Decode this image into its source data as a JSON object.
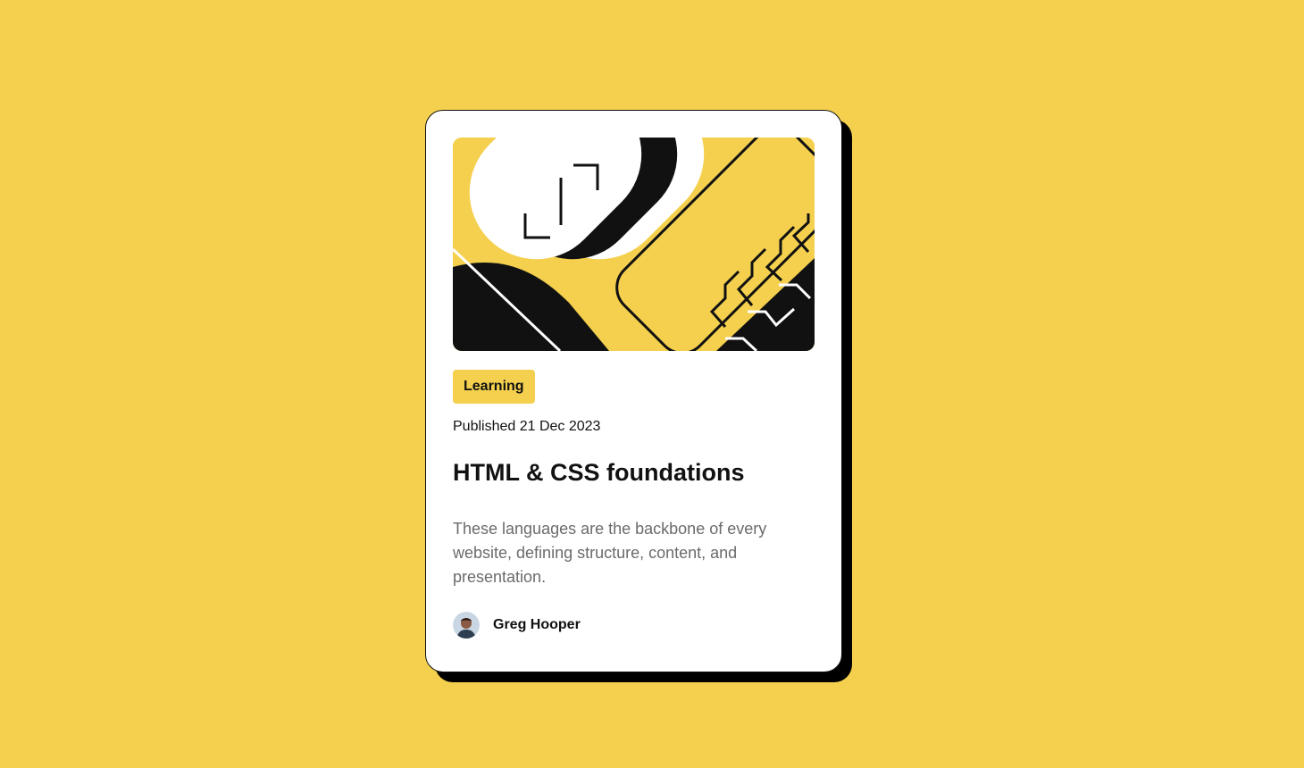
{
  "page": {
    "background_color": "#F4D04E"
  },
  "card": {
    "image": {
      "icon": "code-brackets-illustration"
    },
    "tag": "Learning",
    "published": "Published 21 Dec 2023",
    "title": "HTML & CSS foundations",
    "description": "These languages are the backbone of every website, defining structure, content, and presentation.",
    "author": {
      "name": "Greg Hooper",
      "avatar_icon": "avatar-photo"
    }
  },
  "colors": {
    "accent": "#F4D04E",
    "text_dark": "#111111",
    "text_muted": "#6B6B6B",
    "card_bg": "#FFFFFF"
  }
}
